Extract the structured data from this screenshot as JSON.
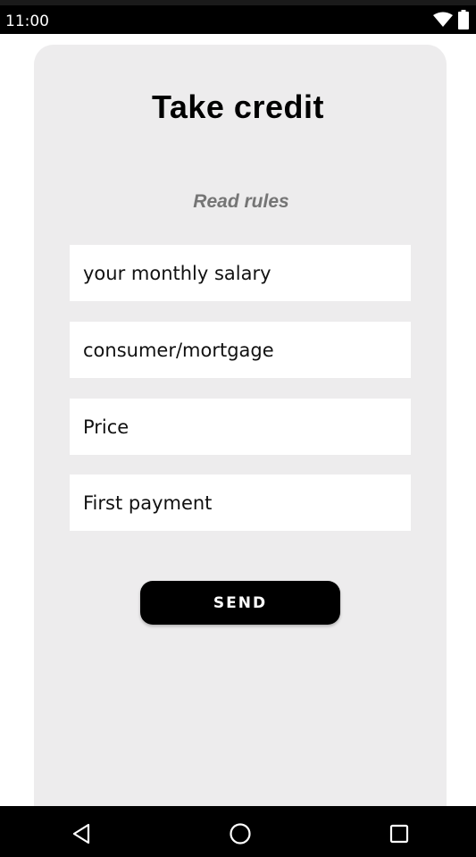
{
  "status_bar": {
    "time": "11:00",
    "icons": [
      "wifi-icon",
      "battery-icon"
    ]
  },
  "form": {
    "title": "Take credit",
    "rules_link": "Read rules",
    "fields": [
      {
        "placeholder": "your monthly salary",
        "value": ""
      },
      {
        "placeholder": "consumer/mortgage",
        "value": ""
      },
      {
        "placeholder": "Price",
        "value": ""
      },
      {
        "placeholder": "First payment",
        "value": ""
      }
    ],
    "submit_label": "SEND"
  },
  "nav_bar": {
    "buttons": [
      "back-icon",
      "home-icon",
      "recents-icon"
    ]
  },
  "colors": {
    "card_background": "#edeced",
    "accent": "#000000",
    "muted_text": "#757575"
  }
}
